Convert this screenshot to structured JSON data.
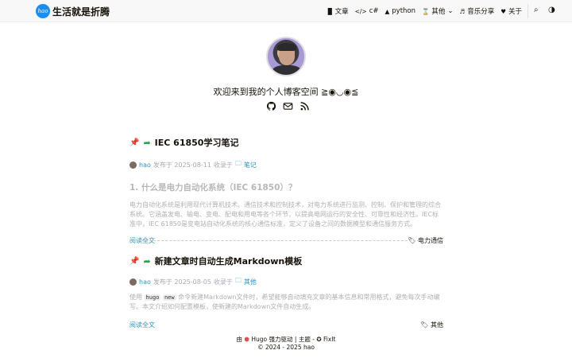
{
  "header": {
    "logo_text": "hao",
    "site_title": "生活就是折腾",
    "nav": [
      {
        "icon": "▉",
        "label": "文章"
      },
      {
        "icon": "</>",
        "label": "c#"
      },
      {
        "icon": "▲",
        "label": "python"
      },
      {
        "icon": "⌛",
        "label": "其他",
        "dropdown": "⌄"
      },
      {
        "icon": "♬",
        "label": "音乐分享"
      },
      {
        "icon": "♥",
        "label": "关于"
      }
    ],
    "search_icon": "⌕",
    "theme_icon": "◑"
  },
  "profile": {
    "subtitle": "欢迎来到我的个人博客空间 ≧◉◡◉≦",
    "social_icons": [
      "github-icon",
      "email-icon",
      "rss-icon"
    ]
  },
  "posts": [
    {
      "title": "IEC 61850学习笔记",
      "author": "hao",
      "date_label": "发布于 2025-08-11",
      "category_label": "收录于",
      "category": "笔记",
      "heading": "1. 什么是电力自动化系统（IEC 61850）？",
      "summary": "电力自动化系统是利用现代计算机技术、通信技术和控制技术，对电力系统进行监测、控制、保护和管理的综合系统。它涵盖发电、输电、变电、配电和用电等各个环节，以提高电网运行的安全性、可靠性和经济性。IEC标准中，IEC 61850是变电站自动化系统的核心通信标准，定义了设备之间的数据模型和通信服务方式。",
      "read_more": "阅读全文",
      "tag": "电力通信"
    },
    {
      "title": "新建文章时自动生成Markdown模板",
      "author": "hao",
      "date_label": "发布于 2025-08-05",
      "category_label": "收录于",
      "category": "其他",
      "summary_prefix": "使用",
      "code1": "hugo",
      "code2": "new",
      "summary": "命令新建Markdown文件时，希望能够自动填充文章的基本信息和常用格式，避免每次手动编写。本文介绍如何配置模板，使新建的Markdown文件自动生成。",
      "read_more": "阅读全文",
      "tag": "其他"
    }
  ],
  "footer": {
    "line1_prefix": "由",
    "line1_hugo": "Hugo 强力驱动",
    "line1_sep": "| 主题 -",
    "line1_theme": "FixIt",
    "line2": "© 2024 - 2025 hao"
  },
  "colors": {
    "accent": "#2d96bd",
    "pin": "#e05050",
    "share": "#2aa44f",
    "logo": "#1d8cf0"
  }
}
